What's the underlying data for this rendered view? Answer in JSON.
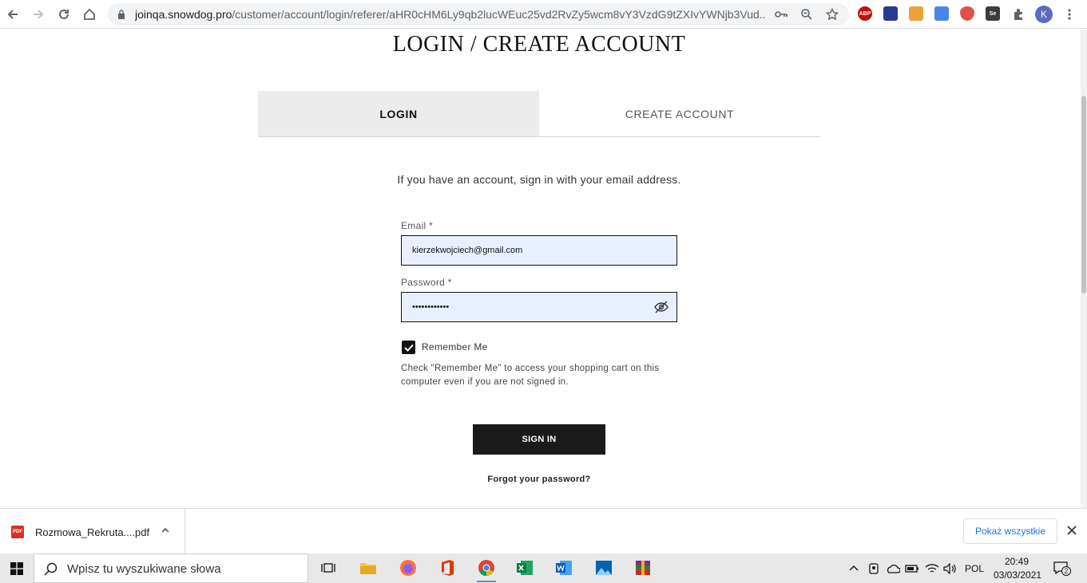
{
  "browser": {
    "url_domain": "joinqa.snowdog.pro",
    "url_path": "/customer/account/login/referer/aHR0cHM6Ly9qb2lucWEuc25vd2RvZy5wcm8vY3VzdG9tZXIvYWNjb3Vud...",
    "profile_initial": "K",
    "extensions": [
      {
        "icon": "abp-icon",
        "label": "ABP",
        "color": "#c70d0d"
      },
      {
        "icon": "ext-blue-icon",
        "label": "",
        "color": "#2a3a8c"
      },
      {
        "icon": "ext-mail-icon",
        "label": "",
        "color": "#e9a33a"
      },
      {
        "icon": "google-translate-icon",
        "label": "",
        "color": "#4a86e8"
      },
      {
        "icon": "shield-ext-icon",
        "label": "",
        "color": "#e0534a"
      },
      {
        "icon": "selenium-ide-icon",
        "label": "Se",
        "color": "#3c3c3c"
      }
    ]
  },
  "page": {
    "title": "LOGIN / CREATE ACCOUNT",
    "tabs": {
      "login": "LOGIN",
      "create": "CREATE ACCOUNT"
    },
    "intro": "If you have an account, sign in with your email address.",
    "email": {
      "label": "Email *",
      "value": "kierzekwojciech@gmail.com"
    },
    "password": {
      "label": "Password *",
      "value": "••••••••••••"
    },
    "remember": {
      "label": "Remember Me",
      "checked": true,
      "help": "Check \"Remember Me\" to access your shopping cart on this computer even if you are not signed in."
    },
    "signin_label": "SIGN IN",
    "forgot_label": "Forgot your password?"
  },
  "downloads": {
    "file_name": "Rozmowa_Rekruta....pdf",
    "file_type": "PDF",
    "show_all": "Pokaż wszystkie"
  },
  "taskbar": {
    "search_placeholder": "Wpisz tu wyszukiwane słowa",
    "language": "POL",
    "time": "20:49",
    "date": "03/03/2021",
    "notifications": "2"
  }
}
